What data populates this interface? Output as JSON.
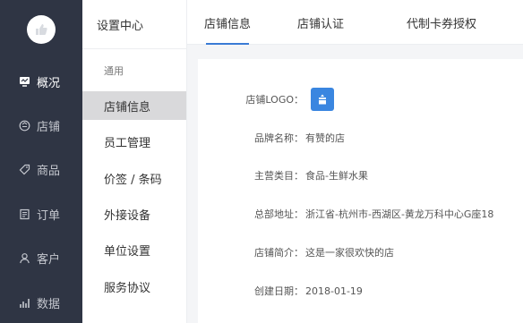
{
  "nav": {
    "items": [
      {
        "label": "概况",
        "icon": "overview-icon"
      },
      {
        "label": "店铺",
        "icon": "store-icon"
      },
      {
        "label": "商品",
        "icon": "tag-icon"
      },
      {
        "label": "订单",
        "icon": "order-icon"
      },
      {
        "label": "客户",
        "icon": "user-icon"
      },
      {
        "label": "数据",
        "icon": "chart-icon"
      }
    ]
  },
  "sub": {
    "title": "设置中心",
    "group": "通用",
    "items": [
      {
        "label": "店铺信息"
      },
      {
        "label": "员工管理"
      },
      {
        "label": "价签 / 条码"
      },
      {
        "label": "外接设备"
      },
      {
        "label": "单位设置"
      },
      {
        "label": "服务协议"
      }
    ]
  },
  "tabs": [
    {
      "label": "店铺信息"
    },
    {
      "label": "店铺认证"
    },
    {
      "label": "代制卡券授权"
    }
  ],
  "info": {
    "logo_label": "店铺LOGO：",
    "rows": [
      {
        "label": "品牌名称：",
        "value": "有赞的店"
      },
      {
        "label": "主营类目：",
        "value": "食品-生鲜水果"
      },
      {
        "label": "总部地址：",
        "value": "浙江省-杭州市-西湖区-黄龙万科中心G座18"
      },
      {
        "label": "店铺简介：",
        "value": "这是一家很欢快的店"
      },
      {
        "label": "创建日期：",
        "value": "2018-01-19"
      }
    ]
  },
  "colors": {
    "nav_bg": "#2f3544",
    "accent": "#3a7bd5",
    "logo_blue": "#3a86e0"
  }
}
